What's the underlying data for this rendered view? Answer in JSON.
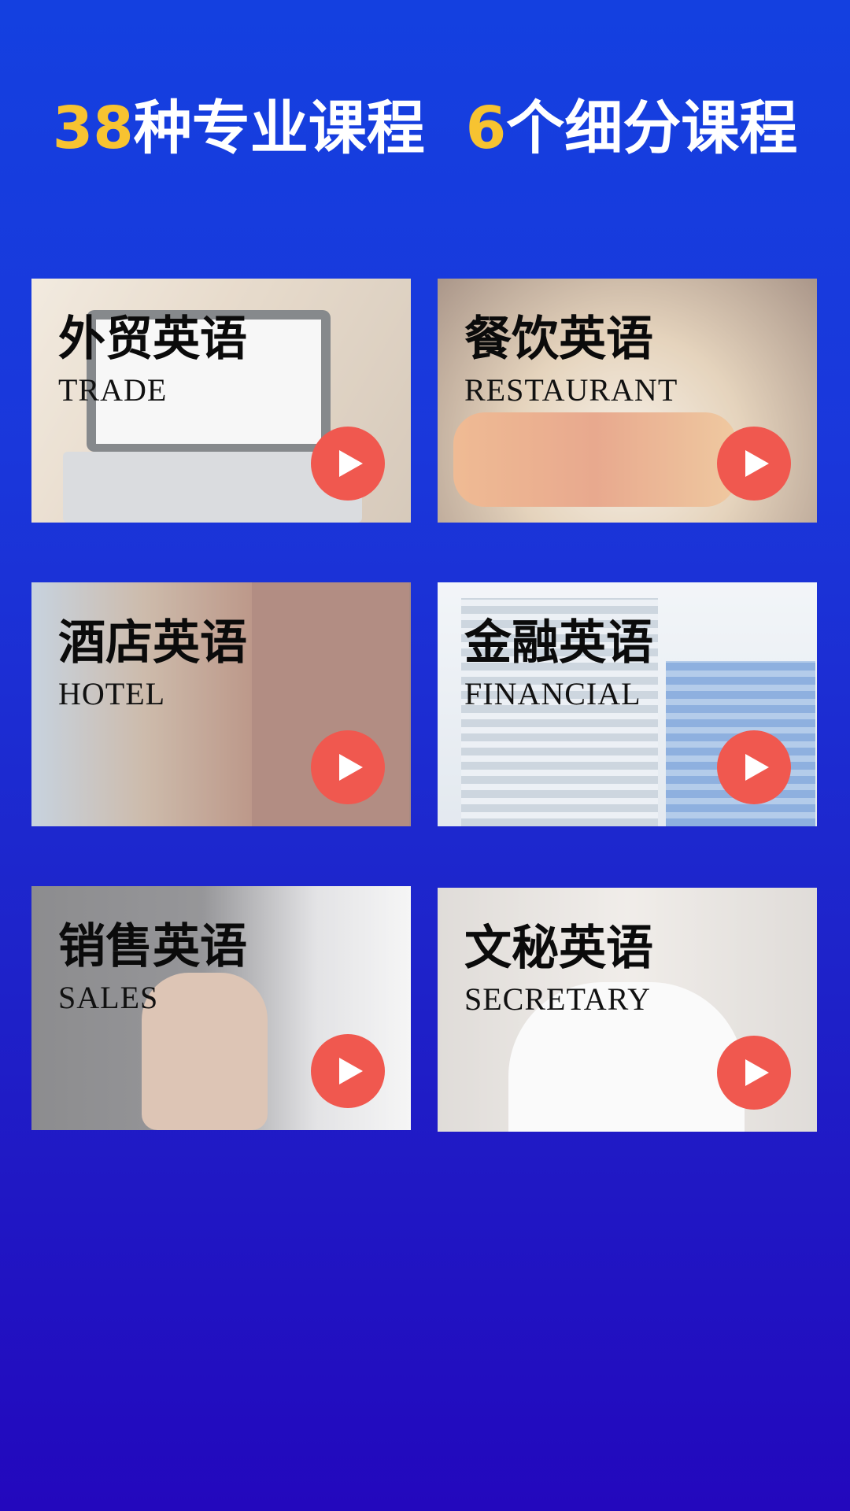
{
  "headline": {
    "part1_num": "38",
    "part1_text": "种专业课程",
    "part2_num": "6",
    "part2_text": "个细分课程"
  },
  "colors": {
    "background_top": "#1440e0",
    "background_bottom": "#2308bd",
    "accent_number": "#f7c331",
    "play_button": "#f0584f"
  },
  "courses": [
    {
      "title_zh": "外贸英语",
      "title_en": "TRADE",
      "icon": "play-icon"
    },
    {
      "title_zh": "餐饮英语",
      "title_en": "RESTAURANT",
      "icon": "play-icon"
    },
    {
      "title_zh": "酒店英语",
      "title_en": "HOTEL",
      "icon": "play-icon"
    },
    {
      "title_zh": "金融英语",
      "title_en": "FINANCIAL",
      "icon": "play-icon"
    },
    {
      "title_zh": "销售英语",
      "title_en": "SALES",
      "icon": "play-icon"
    },
    {
      "title_zh": "文秘英语",
      "title_en": "SECRETARY",
      "icon": "play-icon"
    }
  ]
}
